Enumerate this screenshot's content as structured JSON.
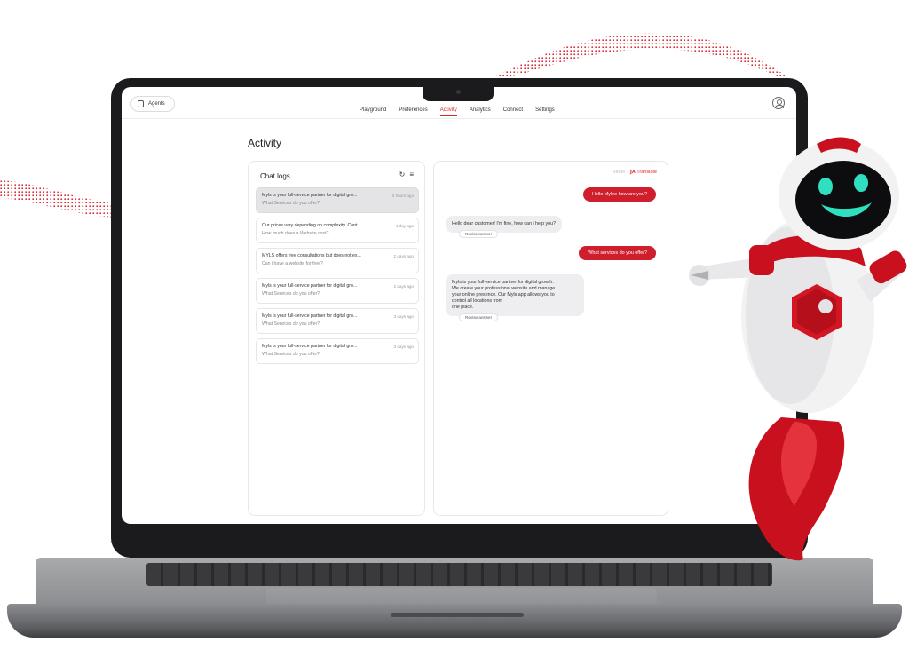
{
  "header": {
    "agents_label": "Agents",
    "nav": [
      "Playground",
      "Preferences",
      "Activity",
      "Analytics",
      "Connect",
      "Settings"
    ],
    "active_tab": "Activity"
  },
  "page": {
    "title": "Activity"
  },
  "chat_logs": {
    "title": "Chat logs",
    "items": [
      {
        "question": "Myls is your full-service partner for digital gro...",
        "answer": "What Services do you offer?",
        "time": "3 hours ago"
      },
      {
        "question": "Our prices vary depending on complexity. Cont...",
        "answer": "How much does a Website cost?",
        "time": "1 day ago"
      },
      {
        "question": "MYLS offers free consultations but does not ex...",
        "answer": "Can i have a website for free?",
        "time": "2 days ago"
      },
      {
        "question": "Myls is your full-service partner for digital gro...",
        "answer": "What Services do you offer?",
        "time": "2 days ago"
      },
      {
        "question": "Myls is your full-service partner for digital gro...",
        "answer": "What Services do you offer?",
        "time": "3 days ago"
      },
      {
        "question": "Myls is your full-service partner for digital gro...",
        "answer": "What Services do you offer?",
        "time": "3 days ago"
      }
    ]
  },
  "conversation": {
    "reset_label": "Reset",
    "translate_label": "Translate",
    "messages": [
      {
        "from": "user",
        "text": "Hello Mylee how are you?"
      },
      {
        "from": "bot",
        "text": "Hello dear customer! I'm fine, how can i help you?",
        "revise": "Revise answer"
      },
      {
        "from": "user",
        "text": "What services do you offer?"
      },
      {
        "from": "bot",
        "lines": [
          "Myls is your full-service partner for digital growth.",
          "We create your professional website and manage",
          "your online presence. Our Myls app allows you to",
          "control all locations from",
          "one place."
        ],
        "revise": "Revise answer"
      }
    ]
  },
  "colors": {
    "accent": "#d8252f",
    "bubble_user": "#cf1f2c",
    "bubble_bot": "#eeeef1"
  }
}
